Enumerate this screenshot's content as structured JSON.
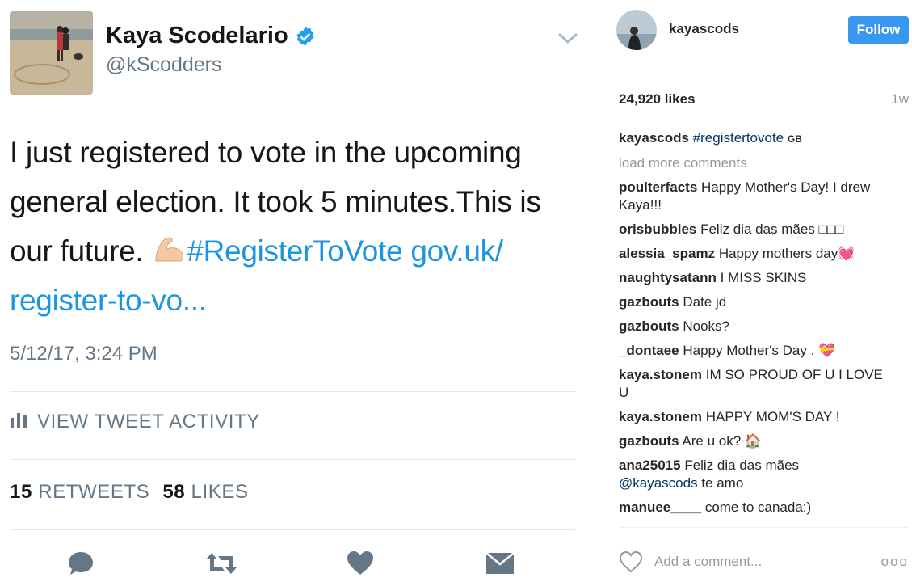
{
  "tweet": {
    "author_name": "Kaya Scodelario",
    "handle": "@kScodders",
    "text_plain": "I just registered to vote in the upcoming general election. It took 5 minutes.This is our future.",
    "hashtag": "#RegisterToVote",
    "link": "gov.uk/ register-to-vo...",
    "timestamp": "5/12/17, 3:24 PM",
    "view_activity": "VIEW TWEET ACTIVITY",
    "retweets_count": "15",
    "retweets_label": "RETWEETS",
    "likes_count": "58",
    "likes_label": "LIKES",
    "link_color": "#1b95e0",
    "verified_color": "#1da1f2"
  },
  "instagram": {
    "username": "kayascods",
    "follow_label": "Follow",
    "likes": "24,920 likes",
    "age": "1w",
    "caption": {
      "user": "kayascods",
      "hashtag": "#registertovote",
      "flag": "GB"
    },
    "load_more": "load more comments",
    "comments": [
      {
        "user": "poulterfacts",
        "text": "Happy Mother's Day! I drew Kaya!!!"
      },
      {
        "user": "orisbubbles",
        "text": "Feliz dia das mães □□□"
      },
      {
        "user": "alessia_spamz",
        "text": "Happy mothers day💓"
      },
      {
        "user": "naughtysatann",
        "text": "I MISS SKINS"
      },
      {
        "user": "gazbouts",
        "text": "Date jd"
      },
      {
        "user": "gazbouts",
        "text": "Nooks?"
      },
      {
        "user": "_dontaee",
        "text": "Happy Mother's Day . 💝"
      },
      {
        "user": "kaya.stonem",
        "text": "IM SO PROUD OF U I LOVE U"
      },
      {
        "user": "kaya.stonem",
        "text": "HAPPY MOM'S DAY !"
      },
      {
        "user": "gazbouts",
        "text": "Are u ok? 🏠"
      },
      {
        "user": "ana25015",
        "text": "Feliz dia das mães",
        "mention": "@kayascods",
        "after": "te amo"
      },
      {
        "user": "manuee____",
        "text": "come to canada:)"
      }
    ],
    "add_comment_placeholder": "Add a comment...",
    "more_label": "ooo",
    "follow_color": "#3897f0"
  }
}
